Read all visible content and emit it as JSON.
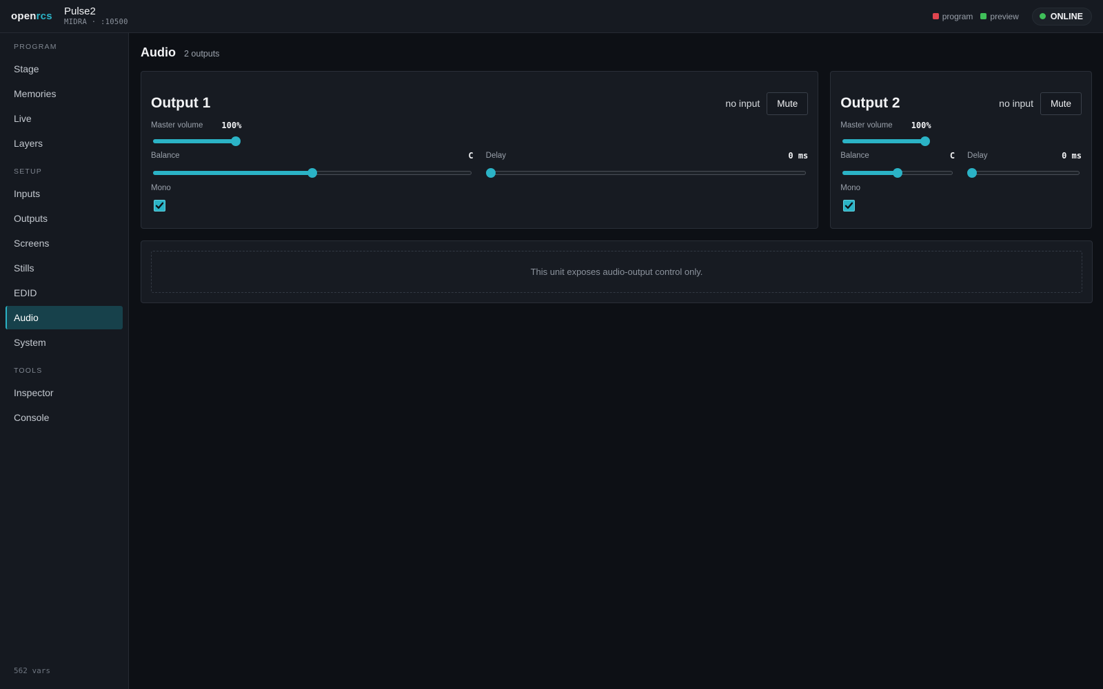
{
  "topbar": {
    "brand_open": "open",
    "brand_rcs": "rcs",
    "device_name": "Pulse2",
    "device_sub": "MIDRA · :10500",
    "legend": [
      {
        "label": "program",
        "color": "#e0454f"
      },
      {
        "label": "preview",
        "color": "#3fbf59"
      }
    ],
    "status": {
      "label": "ONLINE",
      "color": "#3fbf59"
    }
  },
  "sidebar": {
    "sections": [
      {
        "title": "PROGRAM",
        "items": [
          "Stage",
          "Memories",
          "Live",
          "Layers"
        ]
      },
      {
        "title": "SETUP",
        "items": [
          "Inputs",
          "Outputs",
          "Screens",
          "Stills",
          "EDID",
          "Audio",
          "System"
        ]
      },
      {
        "title": "TOOLS",
        "items": [
          "Inspector",
          "Console"
        ]
      }
    ],
    "active_item": "Audio",
    "footer": "562 vars"
  },
  "page": {
    "title": "Audio",
    "subtitle": "2 outputs"
  },
  "outputs": [
    {
      "title": "Output 1",
      "input_status": "no input",
      "mute_label": "Mute",
      "master_volume_label": "Master volume",
      "master_volume_value": "100%",
      "master_volume_fraction": 1.0,
      "balance_label": "Balance",
      "balance_value": "C",
      "balance_fraction": 0.5,
      "delay_label": "Delay",
      "delay_value": "0 ms",
      "delay_fraction": 0.0,
      "mono_label": "Mono",
      "mono_checked": true
    },
    {
      "title": "Output 2",
      "input_status": "no input",
      "mute_label": "Mute",
      "master_volume_label": "Master volume",
      "master_volume_value": "100%",
      "master_volume_fraction": 1.0,
      "balance_label": "Balance",
      "balance_value": "C",
      "balance_fraction": 0.5,
      "delay_label": "Delay",
      "delay_value": "0 ms",
      "delay_fraction": 0.0,
      "mono_label": "Mono",
      "mono_checked": true
    }
  ],
  "info": {
    "message": "This unit exposes audio-output control only."
  },
  "colors": {
    "accent": "#2bb3c6",
    "active_nav_bg": "#17414b"
  }
}
